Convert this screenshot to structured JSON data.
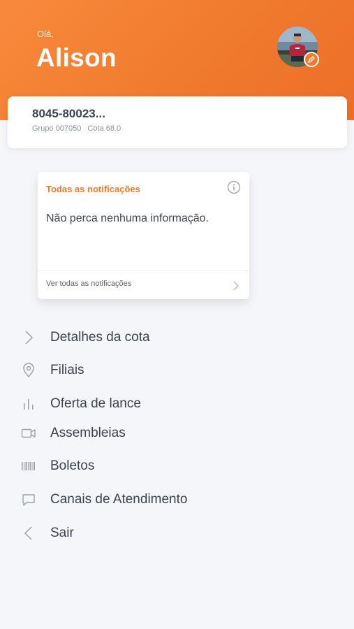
{
  "header": {
    "greeting": "Olá,",
    "user_name": "Alison",
    "accent_color": "#f07a2e"
  },
  "cota": {
    "number": "8045-80023...",
    "group": "Grupo 007050",
    "quota": "Cota 68.0"
  },
  "notifications": {
    "title": "Todas as notificações",
    "message": "Não perca nenhuma informação.",
    "link_label": "Ver todas as notificações",
    "info_icon": "info-icon"
  },
  "menu": [
    {
      "label": "Detalhes da cota",
      "icon": "chevron-right-icon"
    },
    {
      "label": "Filiais",
      "icon": "location-pin-icon"
    },
    {
      "label": "Oferta de lance",
      "icon": "bar-chart-icon"
    },
    {
      "label": "Assembleias",
      "icon": "video-camera-icon"
    },
    {
      "label": "Boletos",
      "icon": "barcode-icon"
    },
    {
      "label": "Canais de Atendimento",
      "icon": "chat-bubble-icon"
    },
    {
      "label": "Sair",
      "icon": "chevron-left-icon"
    }
  ]
}
